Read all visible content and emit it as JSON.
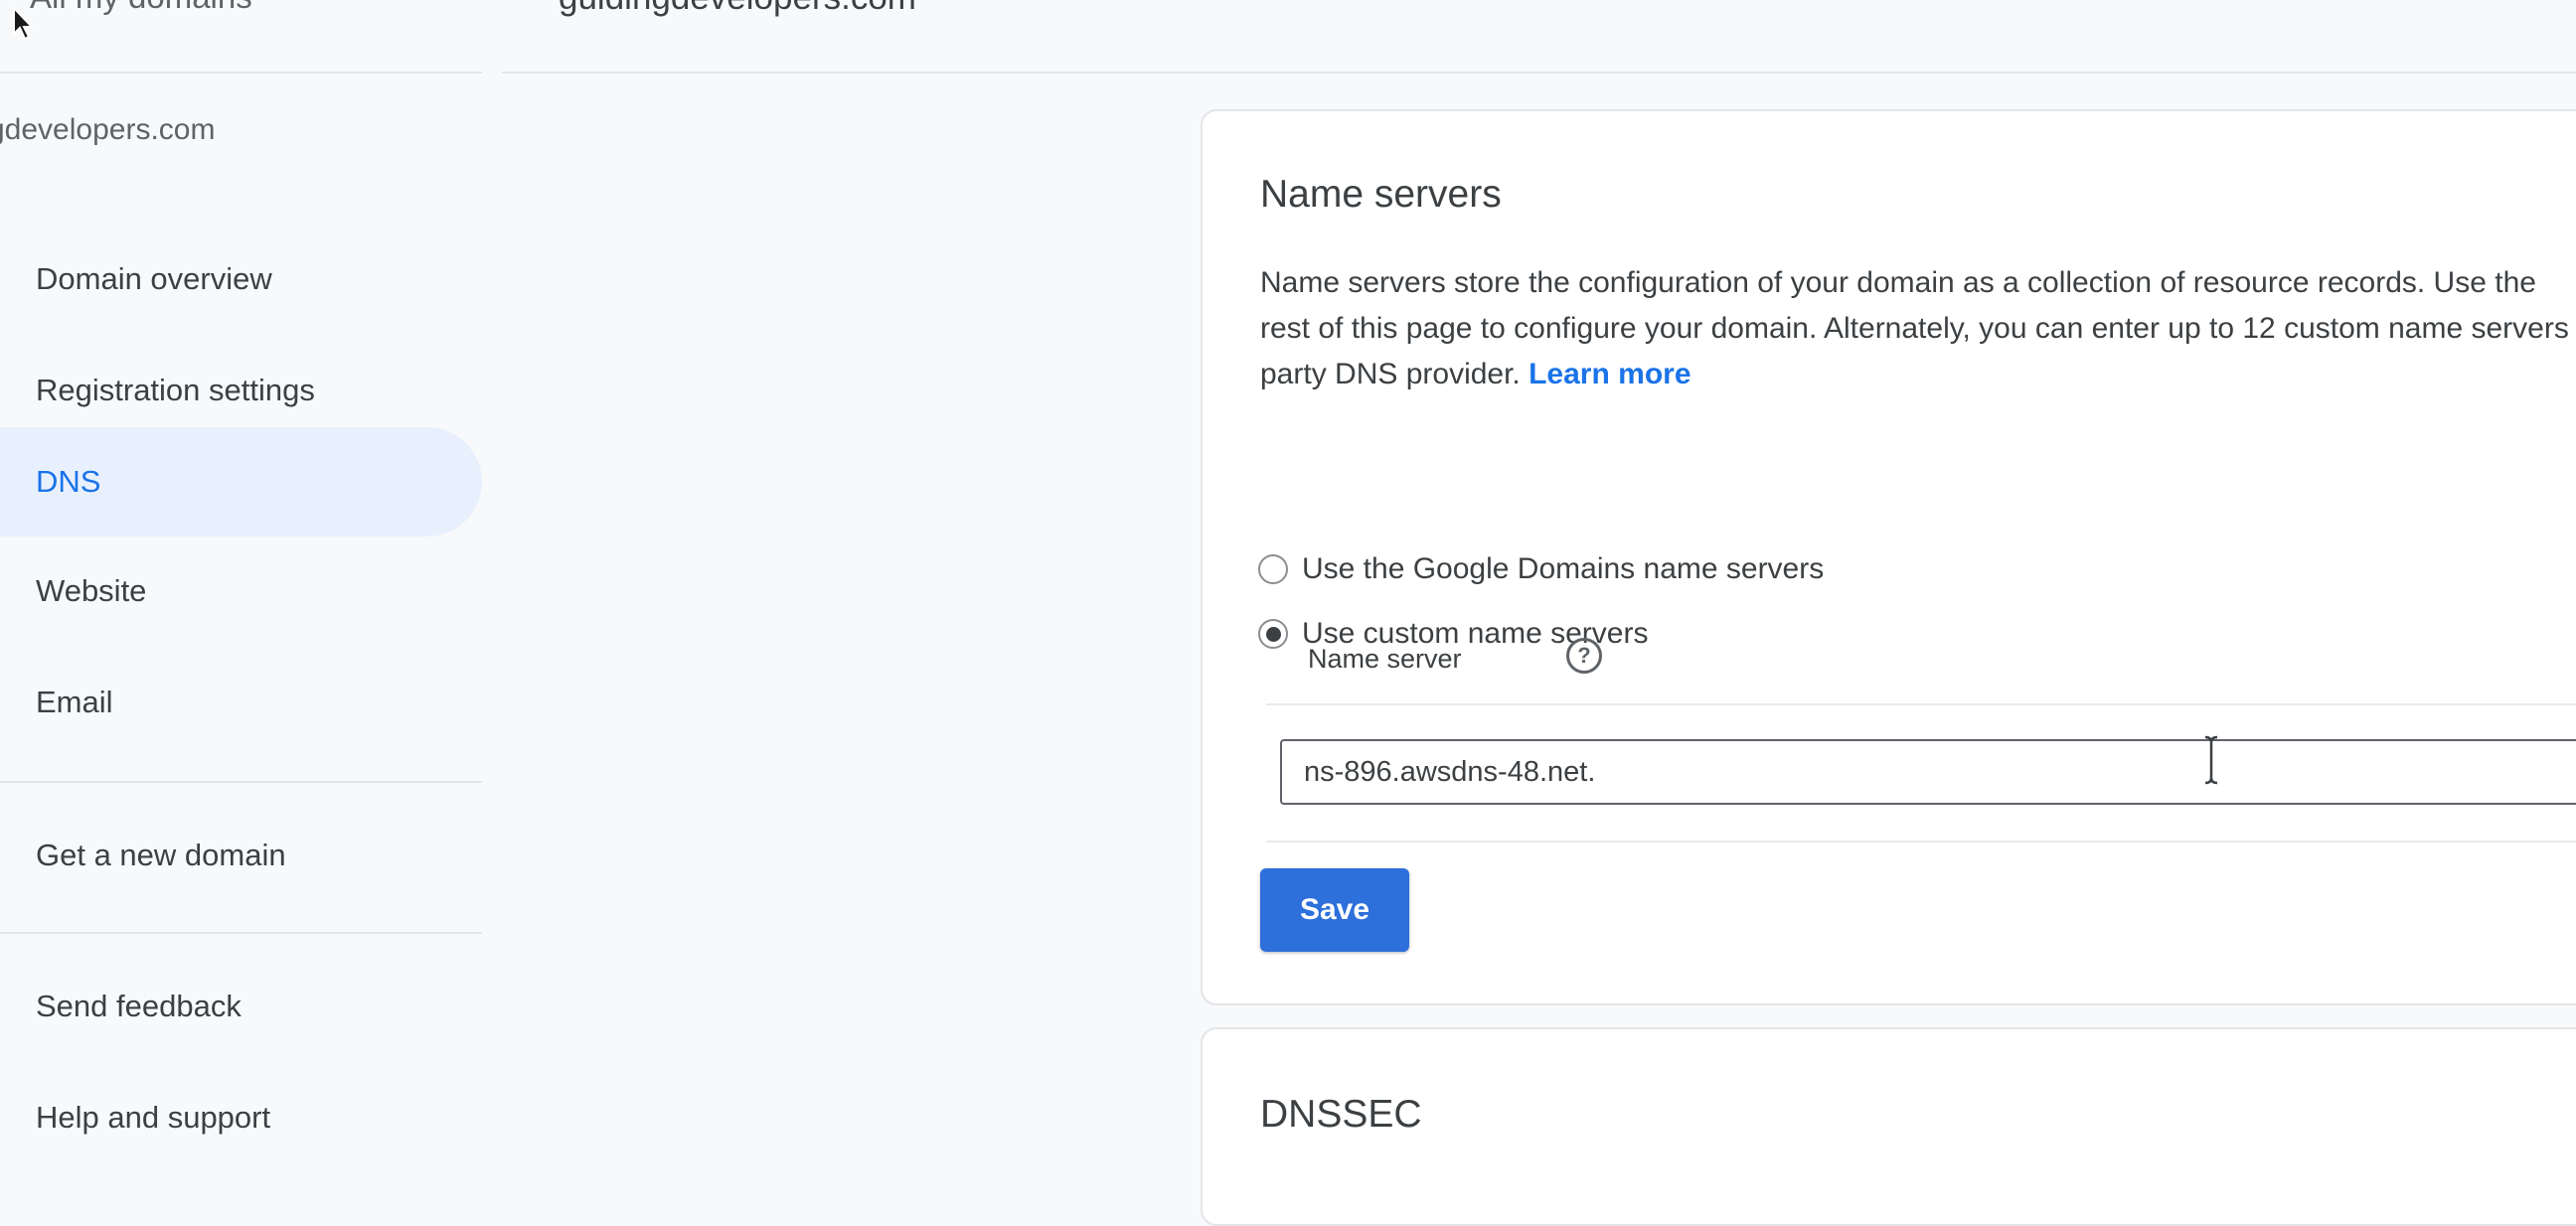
{
  "topbar": {
    "left_label": "All my domains",
    "domain_title": "guidingdevelopers.com"
  },
  "sidebar": {
    "domain": "guidingdevelopers.com",
    "visible_domain_fragment": "gdevelopers.com",
    "items": [
      {
        "label": "Domain overview"
      },
      {
        "label": "Registration settings"
      },
      {
        "label": "DNS",
        "active": true
      },
      {
        "label": "Website"
      },
      {
        "label": "Email"
      }
    ],
    "secondary_items": [
      {
        "label": "Get a new domain"
      }
    ],
    "footer_items": [
      {
        "label": "Send feedback"
      },
      {
        "label": "Help and support"
      }
    ]
  },
  "name_servers": {
    "title": "Name servers",
    "description_lines": [
      "Name servers store the configuration of your domain as a collection of resource records. Use the",
      "rest of this page to configure your domain. Alternately, you can enter up to 12 custom name servers",
      "party DNS provider. "
    ],
    "learn_more_label": "Learn more",
    "options": [
      {
        "label": "Use the Google Domains name servers",
        "selected": false
      },
      {
        "label": "Use custom name servers",
        "selected": true
      }
    ],
    "table_header": "Name server",
    "help_icon_glyph": "?",
    "input_value": "ns-896.awsdns-48.net. ",
    "save_label": "Save"
  },
  "dnssec": {
    "title": "DNSSEC"
  },
  "colors": {
    "accent": "#1a73e8",
    "active_nav_bg": "#e8f0fe",
    "save_button": "#2d6fdb",
    "text": "#3c4043",
    "page_bg": "#f8f9fa"
  }
}
